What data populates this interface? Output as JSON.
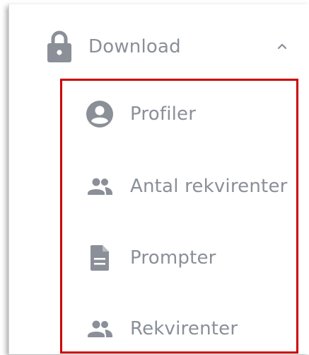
{
  "nav": {
    "section": {
      "label": "Download",
      "icon": "lock-icon",
      "expand_icon": "chevron-up-icon",
      "expanded": true
    },
    "items": [
      {
        "label": "Profiler",
        "icon": "account-circle-icon"
      },
      {
        "label": "Antal rekvirenter",
        "icon": "people-icon"
      },
      {
        "label": "Prompter",
        "icon": "document-icon"
      },
      {
        "label": "Rekvirenter",
        "icon": "people-icon"
      }
    ]
  },
  "colors": {
    "icon": "#8a8f98",
    "text": "#8a8f98",
    "highlight_border": "#cc0000",
    "background": "#ffffff"
  }
}
